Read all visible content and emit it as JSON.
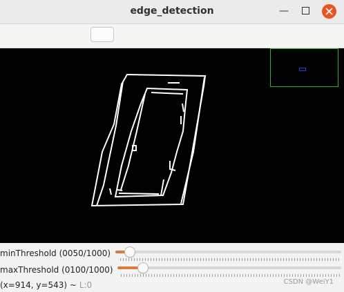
{
  "window": {
    "title": "edge_detection"
  },
  "trackbars": [
    {
      "label": "minThreshold (0050/1000)",
      "value": 50,
      "max": 1000
    },
    {
      "label": "maxThreshold (0100/1000)",
      "value": 100,
      "max": 1000
    }
  ],
  "status": {
    "coords": "(x=914, y=543) ~",
    "level": "L:0"
  },
  "watermark": "CSDN @WeiY1",
  "colors": {
    "close_button": "#e95420",
    "slider_fill": "#e07a3c",
    "minimap_border": "#2db32d",
    "minimap_view": "#1f3fd0"
  }
}
